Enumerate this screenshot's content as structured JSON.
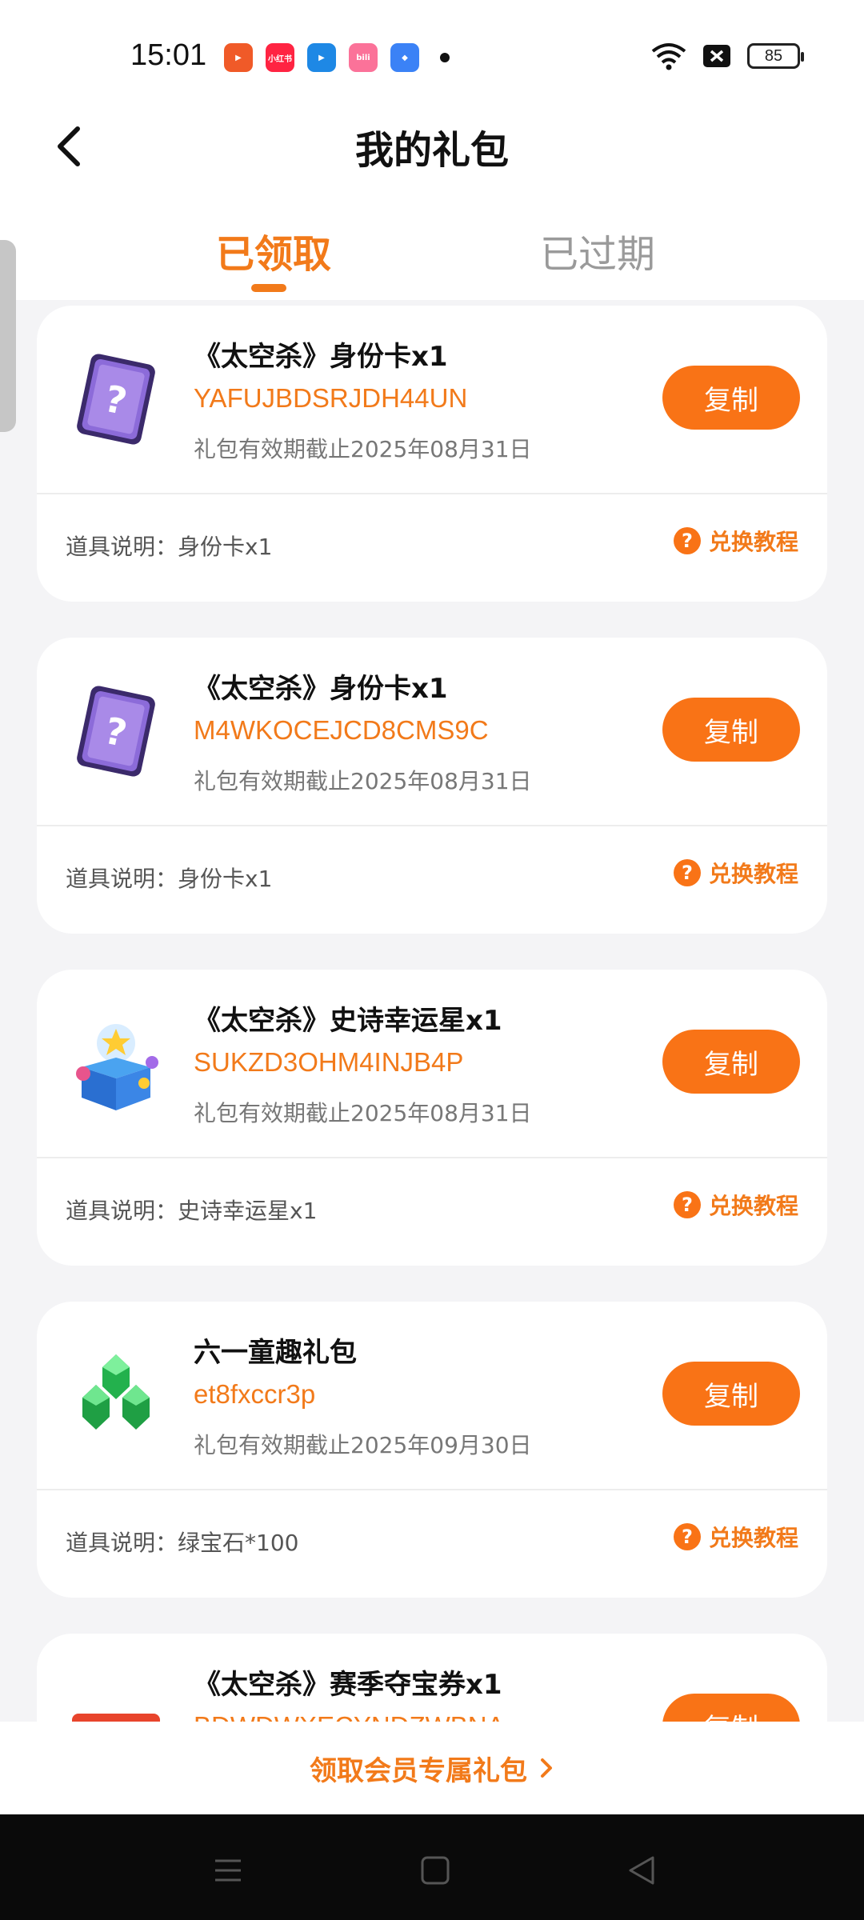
{
  "status_bar": {
    "time": "15:01",
    "battery": "85",
    "notification_icons": [
      {
        "name": "video-app-icon",
        "color": "#f05a28",
        "label": "▶"
      },
      {
        "name": "xiaohongshu-app-icon",
        "color": "#ff2442",
        "label": "小红书"
      },
      {
        "name": "player-app-icon",
        "color": "#1e88e5",
        "label": "▶"
      },
      {
        "name": "bilibili-app-icon",
        "color": "#fb7299",
        "label": "bili"
      },
      {
        "name": "browser-app-icon",
        "color": "#3b82f6",
        "label": "◆"
      }
    ]
  },
  "header": {
    "title": "我的礼包"
  },
  "tabs": [
    {
      "label": "已领取",
      "active": true
    },
    {
      "label": "已过期",
      "active": false
    }
  ],
  "copy_label": "复制",
  "tutorial_label": "兑换教程",
  "gifts": [
    {
      "title": "《太空杀》身份卡x1",
      "code": "YAFUJBDSRJDH44UN",
      "expiry": "礼包有效期截止2025年08月31日",
      "desc": "道具说明：身份卡x1",
      "image": "identity-card"
    },
    {
      "title": "《太空杀》身份卡x1",
      "code": "M4WKOCEJCD8CMS9C",
      "expiry": "礼包有效期截止2025年08月31日",
      "desc": "道具说明：身份卡x1",
      "image": "identity-card"
    },
    {
      "title": "《太空杀》史诗幸运星x1",
      "code": "SUKZD3OHM4INJB4P",
      "expiry": "礼包有效期截止2025年08月31日",
      "desc": "道具说明：史诗幸运星x1",
      "image": "lucky-star-box"
    },
    {
      "title": "六一童趣礼包",
      "code": "et8fxccr3p",
      "expiry": "礼包有效期截止2025年09月30日",
      "desc": "道具说明：绿宝石*100",
      "image": "emerald"
    },
    {
      "title": "《太空杀》赛季夺宝券x1",
      "code": "BDWDWXECYNDZWBNA",
      "expiry": "",
      "desc": "",
      "image": "treasure-ticket"
    }
  ],
  "member_link": "领取会员专属礼包",
  "colors": {
    "accent": "#f27a1a",
    "button": "#f97316",
    "background": "#f4f4f6"
  }
}
